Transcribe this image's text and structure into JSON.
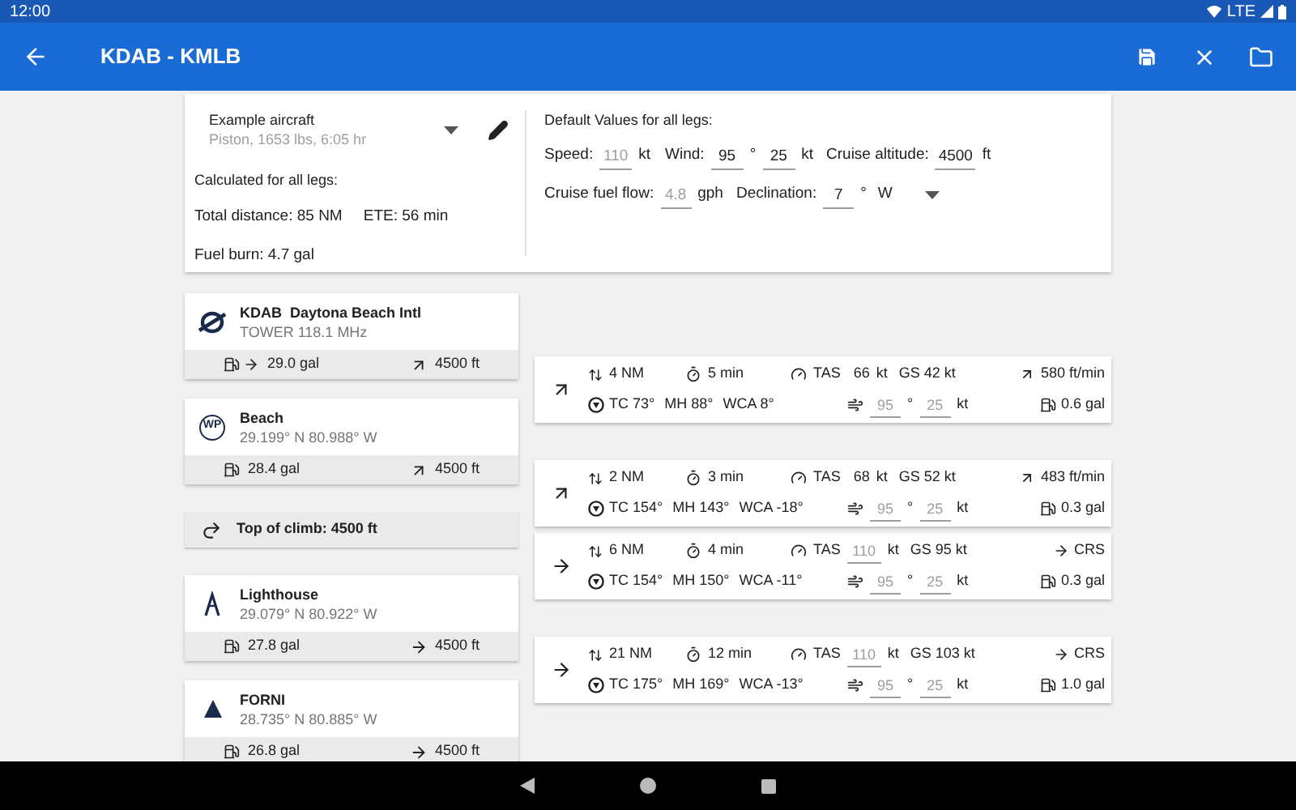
{
  "status_bar": {
    "time": "12:00",
    "network": "LTE"
  },
  "app_bar": {
    "title": "KDAB - KMLB"
  },
  "aircraft": {
    "name": "Example aircraft",
    "details": "Piston, 1653 lbs, 6:05 hr"
  },
  "calculated": {
    "heading": "Calculated for all legs:",
    "total_distance": "Total distance: 85 NM",
    "ete": "ETE: 56 min",
    "fuel_burn": "Fuel burn: 4.7 gal"
  },
  "defaults": {
    "heading": "Default Values for all legs:",
    "speed_label": "Speed:",
    "speed": {
      "placeholder": "110"
    },
    "speed_unit": "kt",
    "wind_label": "Wind:",
    "wind_dir": {
      "value": "95"
    },
    "wind_deg": "°",
    "wind_speed": {
      "value": "25"
    },
    "wind_unit": "kt",
    "altitude_label": "Cruise altitude:",
    "altitude": {
      "value": "4500"
    },
    "altitude_unit": "ft",
    "fuel_flow_label": "Cruise fuel flow:",
    "fuel_flow": {
      "placeholder": "4.8"
    },
    "fuel_flow_unit": "gph",
    "declination_label": "Declination:",
    "declination": {
      "value": "7"
    },
    "declination_deg": "°",
    "declination_dir": "W"
  },
  "waypoints": [
    {
      "kind": "airport",
      "name": "KDAB  Daytona Beach Intl",
      "subtitle": "TOWER 118.1 MHz",
      "fuel": "29.0 gal",
      "fuel_arrow": true,
      "altitude": "4500 ft",
      "climb": true
    },
    {
      "kind": "waypoint",
      "badge": "WP",
      "name": "Beach",
      "subtitle": "29.199° N 80.988° W",
      "fuel": "28.4 gal",
      "fuel_arrow": false,
      "altitude": "4500 ft",
      "climb": true
    },
    {
      "kind": "toc",
      "name": "Top of climb: 4500 ft"
    },
    {
      "kind": "landmark",
      "name": "Lighthouse",
      "subtitle": "29.079° N 80.922° W",
      "fuel": "27.8 gal",
      "fuel_arrow": false,
      "altitude": "4500 ft",
      "climb": false
    },
    {
      "kind": "fix",
      "name": "FORNI",
      "subtitle": "28.735° N 80.885° W",
      "fuel": "26.8 gal",
      "fuel_arrow": false,
      "altitude": "4500 ft",
      "climb": false
    }
  ],
  "legs": [
    {
      "climb": true,
      "distance": "4 NM",
      "time": "5 min",
      "tas_label": "TAS",
      "tas": {
        "kind": "text",
        "value": "66"
      },
      "tas_unit": "kt",
      "gs": "GS 42 kt",
      "rate": "580 ft/min",
      "tc": "TC 73°",
      "mh": "MH 88°",
      "wca": "WCA 8°",
      "wind_dir": {
        "placeholder": "95"
      },
      "wind_deg": "°",
      "wind_speed": {
        "placeholder": "25"
      },
      "wind_unit": "kt",
      "fuel": "0.6 gal"
    },
    {
      "climb": true,
      "distance": "2 NM",
      "time": "3 min",
      "tas_label": "TAS",
      "tas": {
        "kind": "text",
        "value": "68"
      },
      "tas_unit": "kt",
      "gs": "GS 52 kt",
      "rate": "483 ft/min",
      "tc": "TC 154°",
      "mh": "MH 143°",
      "wca": "WCA -18°",
      "wind_dir": {
        "placeholder": "95"
      },
      "wind_deg": "°",
      "wind_speed": {
        "placeholder": "25"
      },
      "wind_unit": "kt",
      "fuel": "0.3 gal"
    },
    {
      "climb": false,
      "distance": "6 NM",
      "time": "4 min",
      "tas_label": "TAS",
      "tas": {
        "kind": "field",
        "placeholder": "110"
      },
      "tas_unit": "kt",
      "gs": "GS 95 kt",
      "rate": "CRS",
      "tc": "TC 154°",
      "mh": "MH 150°",
      "wca": "WCA -11°",
      "wind_dir": {
        "placeholder": "95"
      },
      "wind_deg": "°",
      "wind_speed": {
        "placeholder": "25"
      },
      "wind_unit": "kt",
      "fuel": "0.3 gal"
    },
    {
      "climb": false,
      "distance": "21 NM",
      "time": "12 min",
      "tas_label": "TAS",
      "tas": {
        "kind": "field",
        "placeholder": "110"
      },
      "tas_unit": "kt",
      "gs": "GS 103 kt",
      "rate": "CRS",
      "tc": "TC 175°",
      "mh": "MH 169°",
      "wca": "WCA -13°",
      "wind_dir": {
        "placeholder": "95"
      },
      "wind_deg": "°",
      "wind_speed": {
        "placeholder": "25"
      },
      "wind_unit": "kt",
      "fuel": "1.0 gal"
    }
  ]
}
